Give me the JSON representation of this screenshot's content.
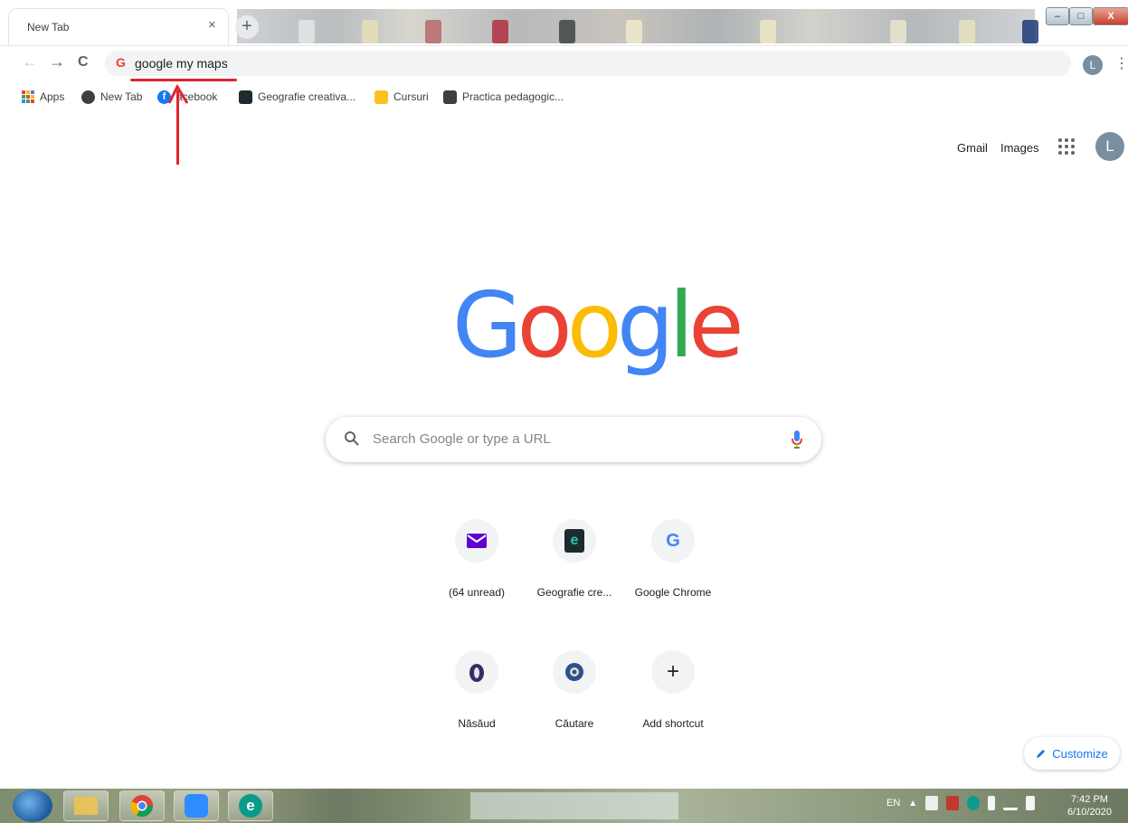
{
  "tab": {
    "title": "New Tab",
    "close_symbol": "×",
    "new_tab_symbol": "+"
  },
  "window_controls": {
    "minimize": "–",
    "maximize": "□",
    "close": "X"
  },
  "toolbar": {
    "back_symbol": "←",
    "forward_symbol": "→",
    "reload_symbol": "C",
    "omnibox_favicon": "G",
    "omnibox_text": "google my maps",
    "profile_initial": "L",
    "menu_symbol": "⋮"
  },
  "bookmarks": [
    {
      "label": "Apps",
      "icon": "apps-grid-icon"
    },
    {
      "label": "New Tab",
      "icon": "globe-icon"
    },
    {
      "label": "acebook",
      "icon": "facebook-icon"
    },
    {
      "label": "Geografie creativa...",
      "icon": "eduapp-icon"
    },
    {
      "label": "Cursuri",
      "icon": "classroom-icon"
    },
    {
      "label": "Practica pedagogic...",
      "icon": "classroom-dark-icon"
    }
  ],
  "top_links": {
    "gmail": "Gmail",
    "images": "Images",
    "profile_initial": "L"
  },
  "logo": {
    "letters": [
      "G",
      "o",
      "o",
      "g",
      "l",
      "e"
    ],
    "colors": [
      "#4285f4",
      "#ea4335",
      "#fbbc05",
      "#4285f4",
      "#34a853",
      "#ea4335"
    ]
  },
  "search": {
    "placeholder": "Search Google or type a URL"
  },
  "shortcuts": [
    {
      "label": "(64 unread)",
      "icon": "mail-icon"
    },
    {
      "label": "Geografie cre...",
      "icon": "eduapp-icon"
    },
    {
      "label": "Google Chrome",
      "icon": "google-g-icon"
    },
    {
      "label": "Năsăud",
      "icon": "nasaud-icon"
    },
    {
      "label": "Căutare",
      "icon": "crest-icon"
    },
    {
      "label": "Add shortcut",
      "icon": "plus-icon"
    }
  ],
  "customize": {
    "label": "Customize"
  },
  "taskbar": {
    "apps": [
      "explorer-icon",
      "chrome-icon",
      "zoom-icon",
      "eset-icon"
    ],
    "language": "EN",
    "clock_time": "7:42 PM",
    "clock_date": "6/10/2020"
  },
  "colors": {
    "accent_blue": "#1a73e8",
    "annotation_red": "#e0252e"
  }
}
